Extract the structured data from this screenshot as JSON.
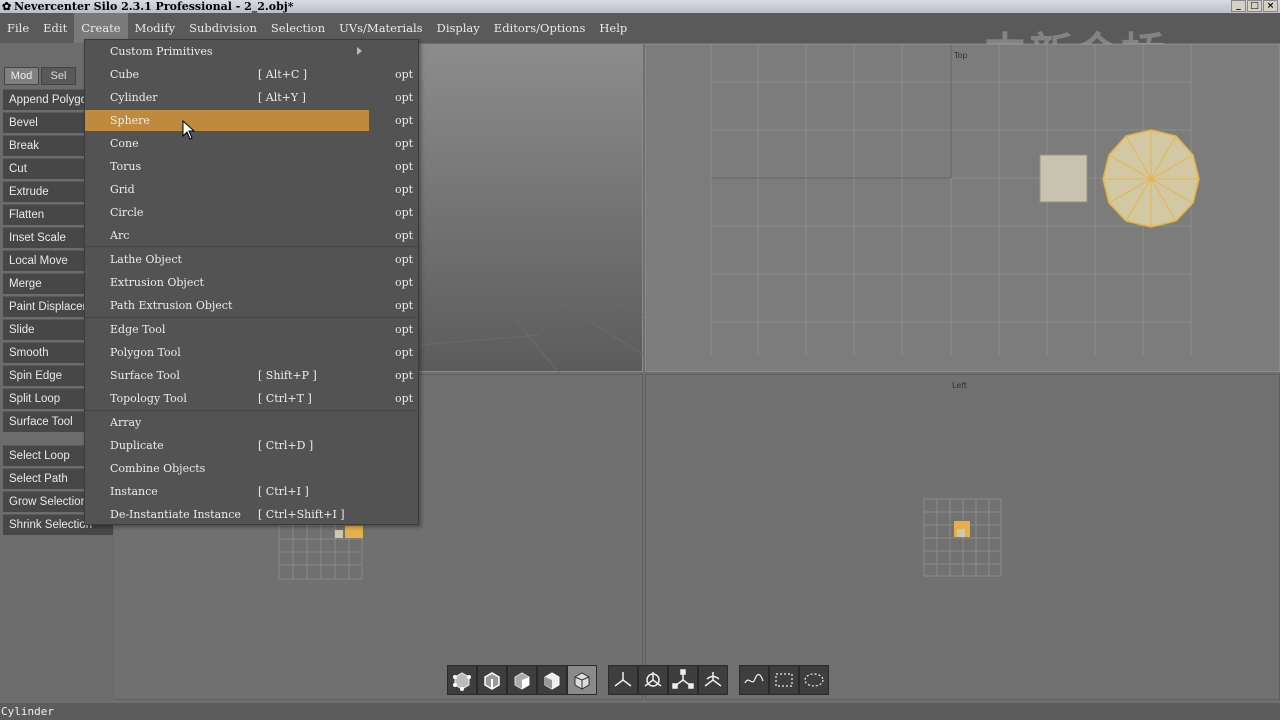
{
  "window": {
    "title": "Nevercenter Silo 2.3.1 Professional - 2_2.obj*",
    "buttons": [
      "_",
      "□",
      "×"
    ]
  },
  "menubar": {
    "items": [
      "File",
      "Edit",
      "Create",
      "Modify",
      "Subdivision",
      "Selection",
      "UVs/Materials",
      "Display",
      "Editors/Options",
      "Help"
    ],
    "active_index": 2
  },
  "watermark": "中新金桥",
  "left_panel": {
    "tabs": [
      "Mod",
      "Sel"
    ],
    "tools": [
      "Append Polygon",
      "Bevel",
      "Break",
      "Cut",
      "Extrude",
      "Flatten",
      "Inset Scale",
      "Local Move",
      "Merge",
      "Paint Displacement",
      "Slide",
      "Smooth",
      "Spin Edge",
      "Split Loop",
      "Surface Tool"
    ],
    "selection_tools": [
      "Select Loop",
      "Select Path",
      "Grow Selection",
      "Shrink Selection"
    ]
  },
  "viewports": {
    "top_label": "Top",
    "left_label": "Left"
  },
  "create_menu": {
    "items": [
      {
        "label": "Custom Primitives",
        "shortcut": "",
        "opt": "",
        "submenu": true
      },
      {
        "label": "Cube",
        "shortcut": "[ Alt+C ]",
        "opt": "opt"
      },
      {
        "label": "Cylinder",
        "shortcut": "[ Alt+Y ]",
        "opt": "opt"
      },
      {
        "label": "Sphere",
        "shortcut": "",
        "opt": "opt",
        "highlighted": true
      },
      {
        "label": "Cone",
        "shortcut": "",
        "opt": "opt"
      },
      {
        "label": "Torus",
        "shortcut": "",
        "opt": "opt"
      },
      {
        "label": "Grid",
        "shortcut": "",
        "opt": "opt"
      },
      {
        "label": "Circle",
        "shortcut": "",
        "opt": "opt"
      },
      {
        "label": "Arc",
        "shortcut": "",
        "opt": "opt"
      },
      {
        "label": "Lathe Object",
        "shortcut": "",
        "opt": "opt"
      },
      {
        "label": "Extrusion Object",
        "shortcut": "",
        "opt": "opt"
      },
      {
        "label": "Path Extrusion Object",
        "shortcut": "",
        "opt": "opt"
      },
      {
        "label": "Edge Tool",
        "shortcut": "",
        "opt": "opt"
      },
      {
        "label": "Polygon Tool",
        "shortcut": "",
        "opt": "opt"
      },
      {
        "label": "Surface Tool",
        "shortcut": "[ Shift+P ]",
        "opt": "opt"
      },
      {
        "label": "Topology Tool",
        "shortcut": "[ Ctrl+T ]",
        "opt": "opt"
      },
      {
        "label": "Array",
        "shortcut": "",
        "opt": ""
      },
      {
        "label": "Duplicate",
        "shortcut": "[ Ctrl+D ]",
        "opt": ""
      },
      {
        "label": "Combine Objects",
        "shortcut": "",
        "opt": ""
      },
      {
        "label": "Instance",
        "shortcut": "[ Ctrl+I ]",
        "opt": ""
      },
      {
        "label": "De-Instantiate Instance",
        "shortcut": "[ Ctrl+Shift+I ]",
        "opt": ""
      }
    ]
  },
  "toolbar": {
    "groups": [
      [
        "vertex-mode-icon",
        "edge-mode-icon",
        "face-mode-icon",
        "object-mode-icon",
        "all-mode-icon"
      ],
      [
        "move-icon",
        "rotate-icon",
        "scale-icon",
        "universal-icon"
      ],
      [
        "lasso-select-icon",
        "box-select-icon",
        "paint-select-icon"
      ]
    ]
  },
  "statusbar": {
    "text": "Cylinder"
  },
  "colors": {
    "highlight": "#c08a3e",
    "background": "#6f6f6f",
    "menu": "#535353"
  }
}
